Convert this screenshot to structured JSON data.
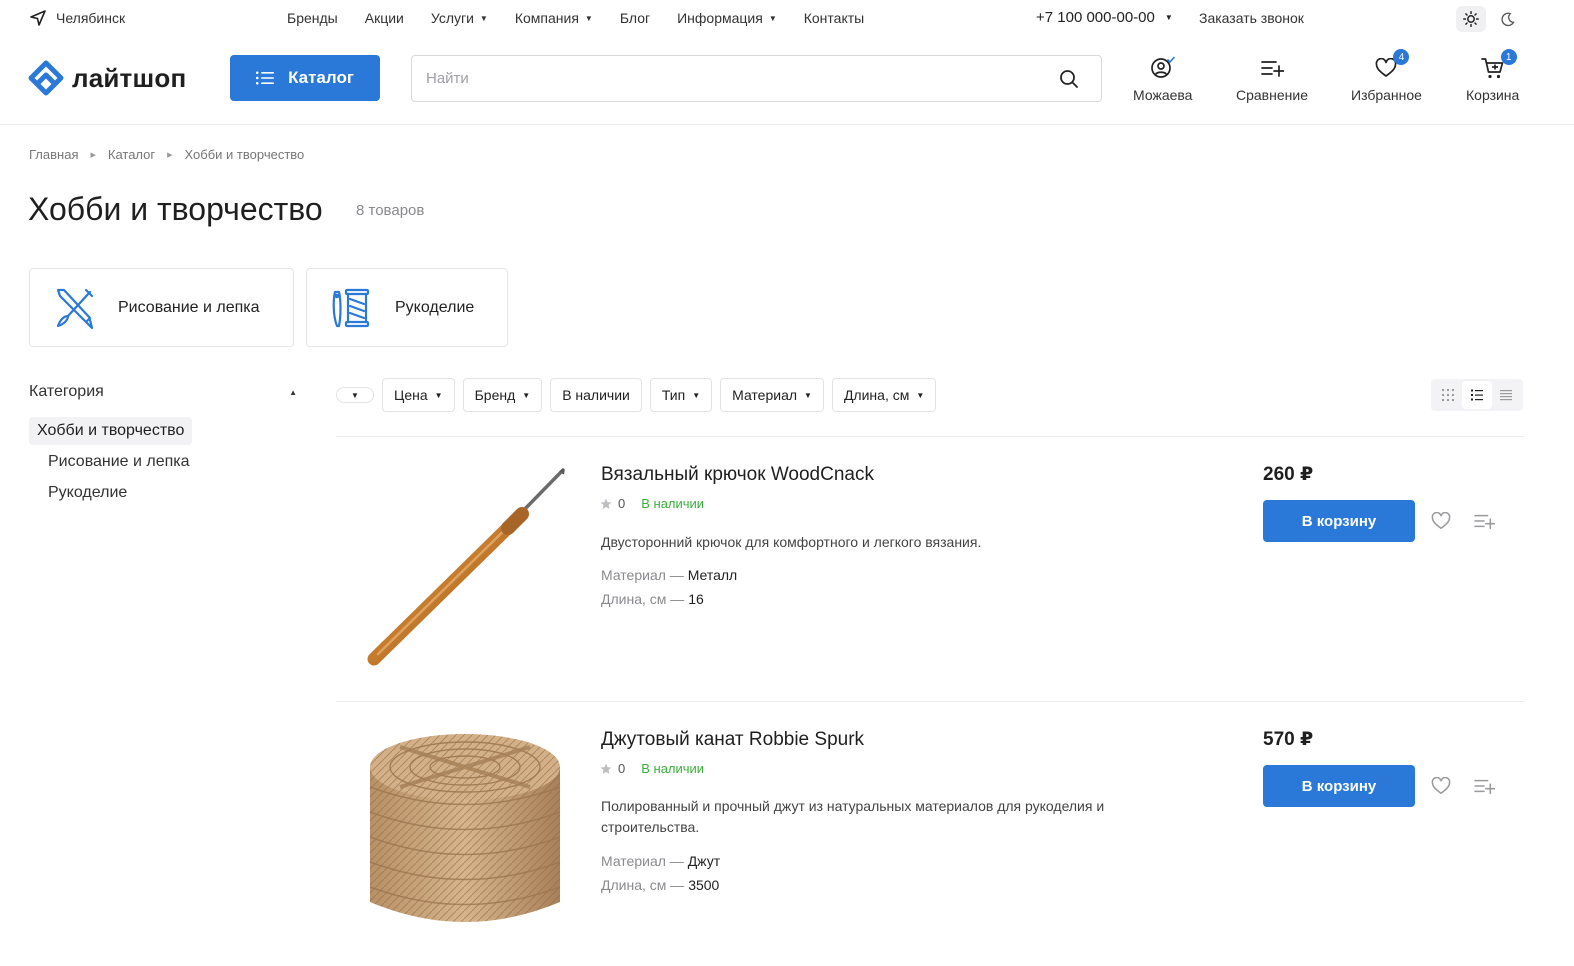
{
  "topbar": {
    "city": "Челябинск",
    "nav": [
      {
        "label": "Бренды",
        "has_caret": false
      },
      {
        "label": "Акции",
        "has_caret": false
      },
      {
        "label": "Услуги",
        "has_caret": true
      },
      {
        "label": "Компания",
        "has_caret": true
      },
      {
        "label": "Блог",
        "has_caret": false
      },
      {
        "label": "Информация",
        "has_caret": true
      },
      {
        "label": "Контакты",
        "has_caret": false
      }
    ],
    "phone": "+7 100 000-00-00",
    "callback": "Заказать звонок"
  },
  "header": {
    "logo_text": "лайтшоп",
    "catalog_label": "Каталог",
    "search_placeholder": "Найти",
    "account_label": "Можаева",
    "compare_label": "Сравнение",
    "favorites_label": "Избранное",
    "favorites_count": "4",
    "cart_label": "Корзина",
    "cart_count": "1"
  },
  "breadcrumb": {
    "home": "Главная",
    "catalog": "Каталог",
    "current": "Хобби и творчество"
  },
  "page": {
    "title": "Хобби и творчество",
    "count": "8 товаров"
  },
  "subcategories": [
    {
      "label": "Рисование и лепка",
      "icon": "brush-pencil-icon"
    },
    {
      "label": "Рукоделие",
      "icon": "thread-needle-icon"
    }
  ],
  "sidebar": {
    "heading": "Категория",
    "active": "Хобби и творчество",
    "items": [
      "Рисование и лепка",
      "Рукоделие"
    ]
  },
  "filters": [
    "Цена",
    "Бренд",
    "В наличии",
    "Тип",
    "Материал",
    "Длина, см"
  ],
  "products": [
    {
      "title": "Вязальный крючок WoodCnack",
      "rating": "0",
      "stock": "В наличии",
      "description": "Двусторонний крючок для комфортного и легкого вязания.",
      "props": [
        {
          "name": "Материал",
          "value": "Металл"
        },
        {
          "name": "Длина, см",
          "value": "16"
        }
      ],
      "price": "260 ₽",
      "button": "В корзину"
    },
    {
      "title": "Джутовый канат Robbie Spurk",
      "rating": "0",
      "stock": "В наличии",
      "description": "Полированный и прочный джут из натуральных материалов для рукоделия и строительства.",
      "props": [
        {
          "name": "Материал",
          "value": "Джут"
        },
        {
          "name": "Длина, см",
          "value": "3500"
        }
      ],
      "price": "570 ₽",
      "button": "В корзину"
    }
  ],
  "colors": {
    "accent": "#2a78d8",
    "stock": "#3cae3c"
  }
}
